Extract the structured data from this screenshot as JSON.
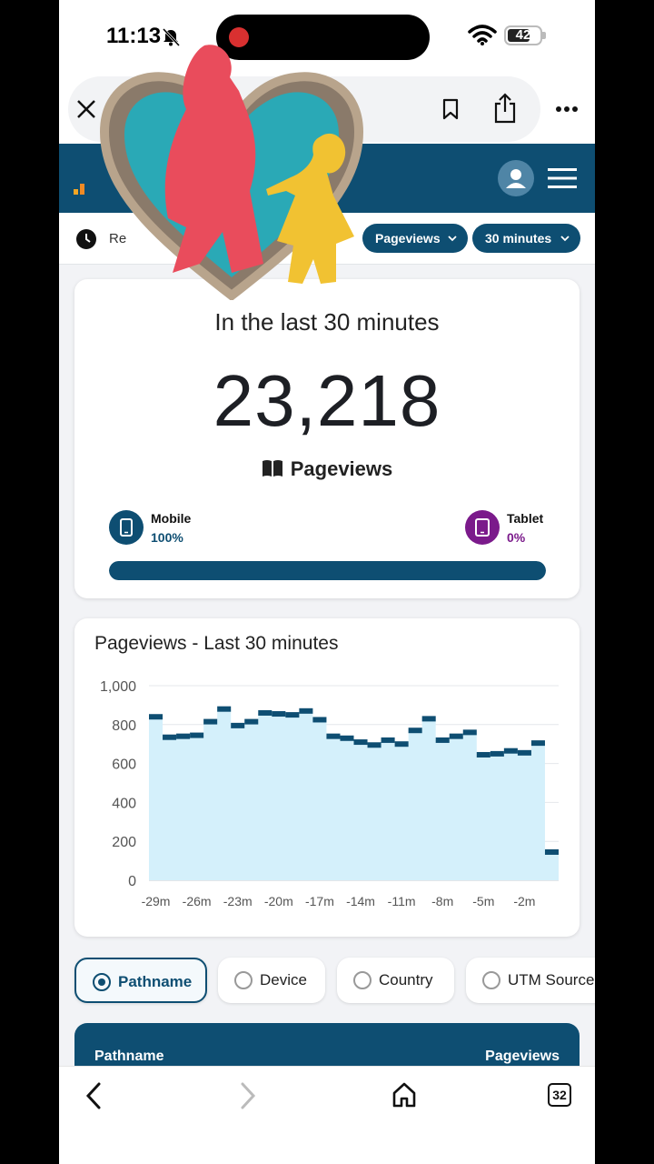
{
  "status_bar": {
    "time": "11:13",
    "battery": "42"
  },
  "toolbar": {
    "label": "Re",
    "metric_filter": "Pageviews",
    "range_filter": "30 minutes"
  },
  "summary": {
    "title": "In the last 30 minutes",
    "total": "23,218",
    "metric": "Pageviews",
    "devices": [
      {
        "name": "Mobile",
        "percent": "100%"
      },
      {
        "name": "Tablet",
        "percent": "0%"
      }
    ],
    "mobile_share": 1.0
  },
  "chart_data": {
    "type": "area",
    "title": "Pageviews - Last 30 minutes",
    "xlabel": "",
    "ylabel": "",
    "ylim": [
      0,
      1000
    ],
    "yticks": [
      "0",
      "200",
      "400",
      "600",
      "800",
      "1,000"
    ],
    "xticks": [
      "-29m",
      "-26m",
      "-23m",
      "-20m",
      "-17m",
      "-14m",
      "-11m",
      "-8m",
      "-5m",
      "-2m"
    ],
    "x": [
      -29,
      -28,
      -27,
      -26,
      -25,
      -24,
      -23,
      -22,
      -21,
      -20,
      -19,
      -18,
      -17,
      -16,
      -15,
      -14,
      -13,
      -12,
      -11,
      -10,
      -9,
      -8,
      -7,
      -6,
      -5,
      -4,
      -3,
      -2,
      -1,
      0
    ],
    "values": [
      840,
      735,
      740,
      745,
      815,
      880,
      795,
      815,
      860,
      855,
      850,
      870,
      825,
      740,
      730,
      710,
      695,
      720,
      700,
      770,
      830,
      720,
      740,
      760,
      645,
      650,
      665,
      655,
      705,
      145
    ]
  },
  "tabs": [
    {
      "label": "Pathname",
      "active": true
    },
    {
      "label": "Device",
      "active": false
    },
    {
      "label": "Country",
      "active": false
    },
    {
      "label": "UTM Source",
      "active": false
    }
  ],
  "table": {
    "col_left": "Pathname",
    "col_right": "Pageviews"
  },
  "bottom_bar": {
    "tab_count": "32"
  },
  "colors": {
    "primary": "#0e4e72",
    "tablet": "#7b1a8b",
    "area_fill": "#d4f0fb"
  }
}
